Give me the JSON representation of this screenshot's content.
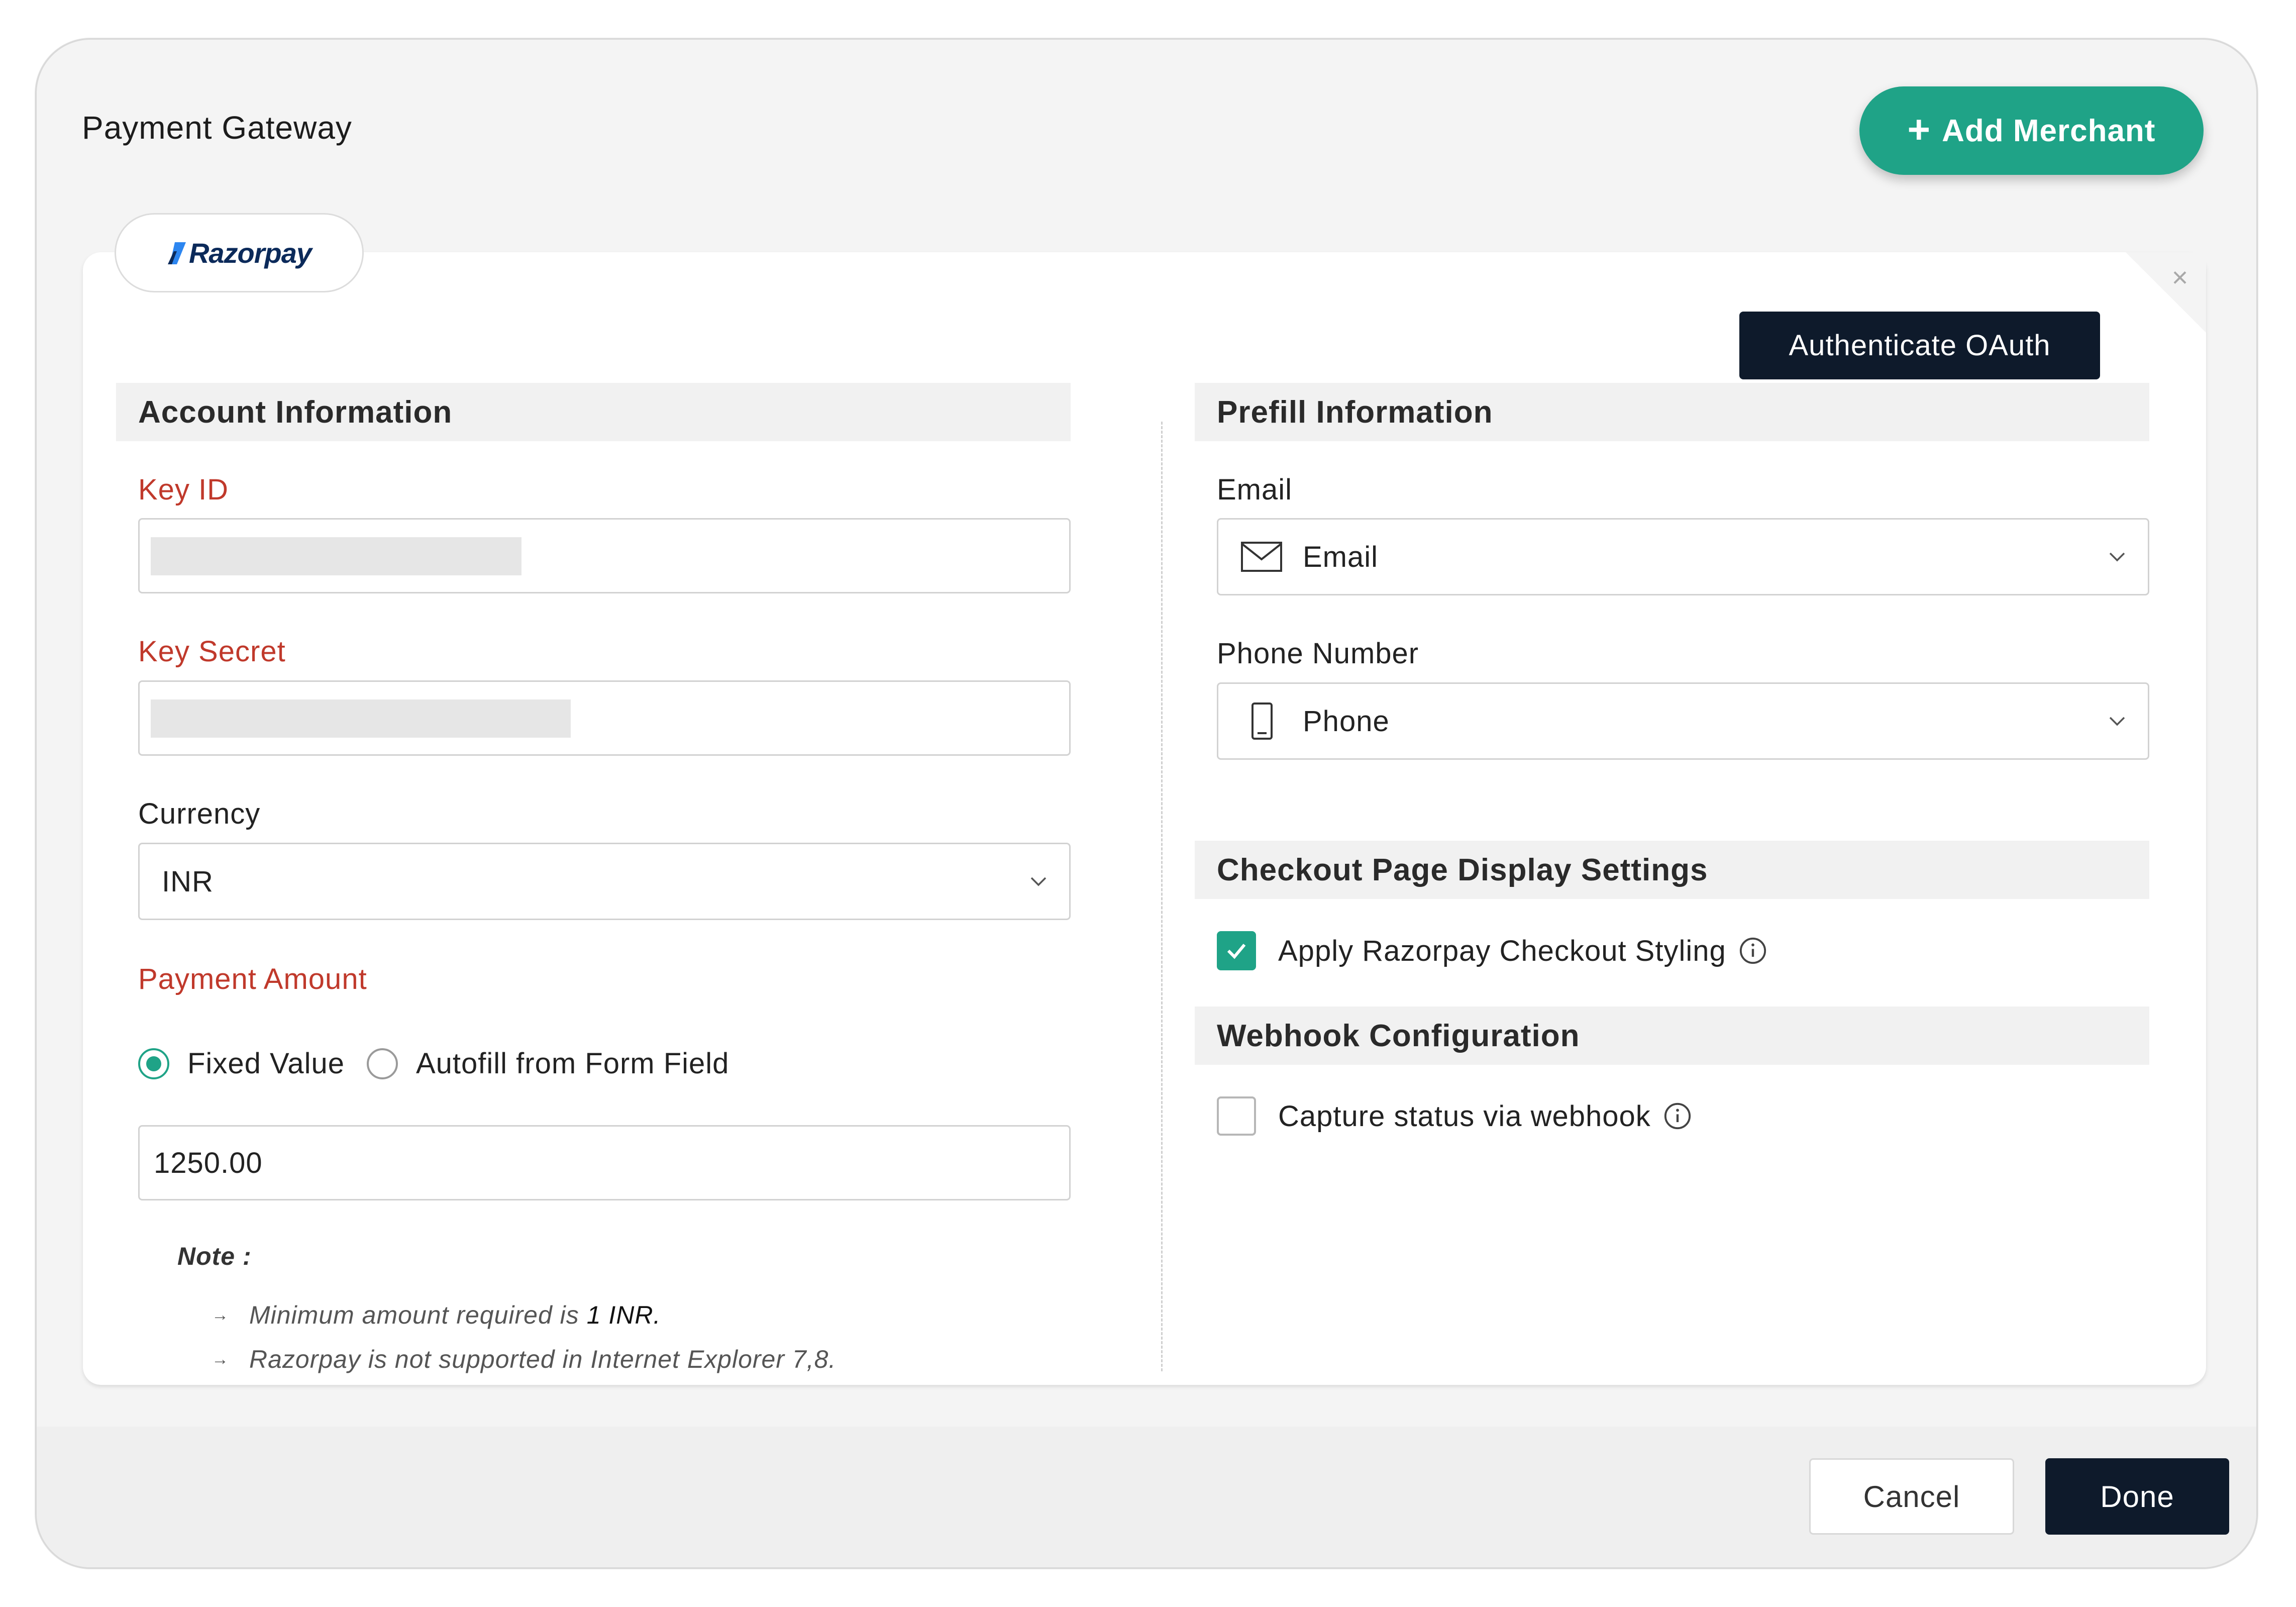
{
  "dialog": {
    "title": "Payment Gateway",
    "add_merchant_label": "Add Merchant"
  },
  "tab": {
    "label": "Razorpay"
  },
  "auth_button": "Authenticate OAuth",
  "account": {
    "heading": "Account Information",
    "key_id_label": "Key ID",
    "key_secret_label": "Key Secret",
    "currency_label": "Currency",
    "currency_value": "INR",
    "payment_amount_label": "Payment Amount",
    "radio_fixed": "Fixed Value",
    "radio_autofill": "Autofill from Form Field",
    "amount_value": "1250.00",
    "note_title": "Note :",
    "note_1_prefix": "Minimum amount required is ",
    "note_1_emph": "1 INR.",
    "note_2": "Razorpay is not supported in Internet Explorer 7,8."
  },
  "prefill": {
    "heading": "Prefill Information",
    "email_label": "Email",
    "email_value": "Email",
    "phone_label": "Phone Number",
    "phone_value": "Phone"
  },
  "checkout": {
    "heading": "Checkout Page Display Settings",
    "apply_styling_label": "Apply Razorpay Checkout Styling",
    "apply_styling_checked": true
  },
  "webhook": {
    "heading": "Webhook Configuration",
    "capture_label": "Capture status via webhook",
    "capture_checked": false
  },
  "footer": {
    "cancel_label": "Cancel",
    "done_label": "Done"
  },
  "colors": {
    "accent": "#1fa387",
    "primary_dark": "#0e1a2b",
    "required_label": "#c0392b"
  },
  "icons": [
    "plus-icon",
    "razorpay-logo-icon",
    "close-icon",
    "chevron-down-icon",
    "mail-icon",
    "phone-icon",
    "check-icon",
    "info-icon",
    "arrow-right-icon"
  ]
}
